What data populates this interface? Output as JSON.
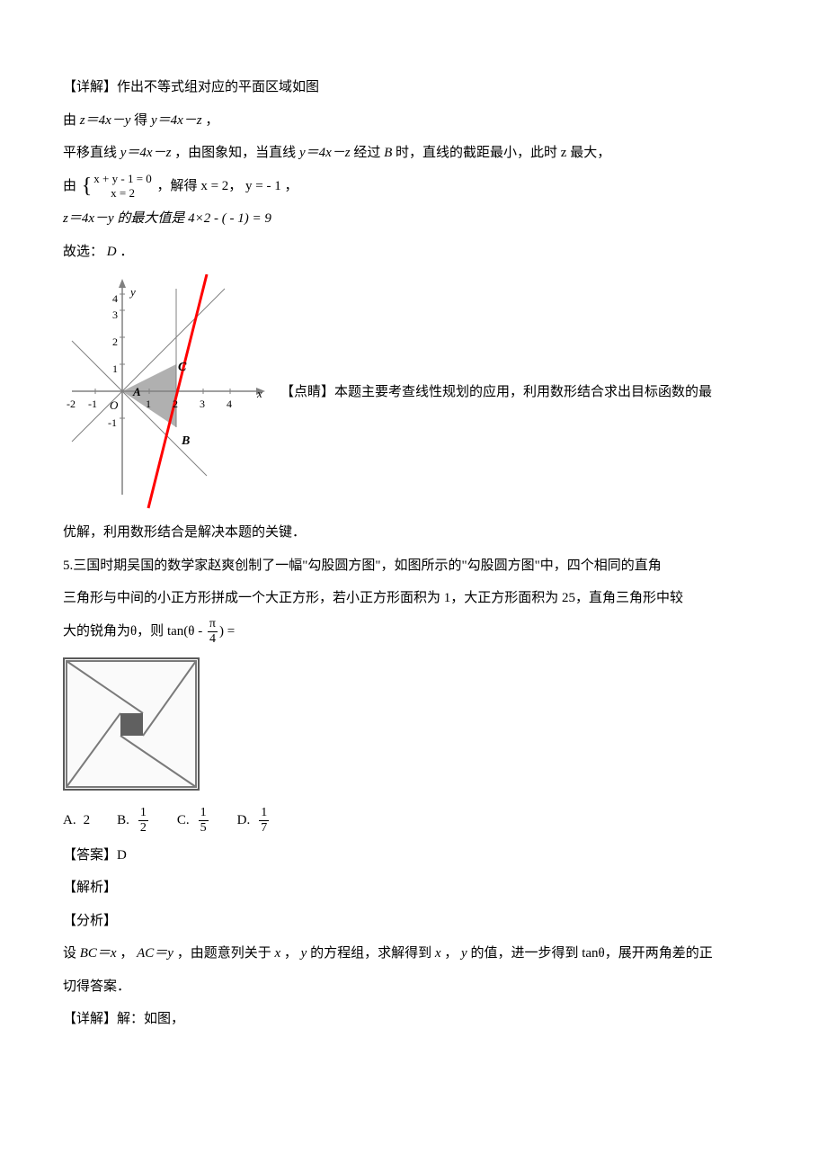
{
  "p1": "【详解】作出不等式组对应的平面区域如图",
  "p2_pre": "由 ",
  "p2_mid": " 得 ",
  "p2_end": "，",
  "eq_z": "z＝4x－y",
  "eq_y": "y＝4x－z",
  "p3_pre": "平移直线 ",
  "p3_mid": "，由图象知，当直线 ",
  "p3_post": " 经过 ",
  "p3_B": "B",
  "p3_end": " 时，直线的截距最小，此时 z 最大，",
  "p4_pre": "由",
  "brace_top": "x + y - 1 = 0",
  "brace_bot": "x = 2",
  "p4_mid": "，解得 ",
  "p4_sol": "x = 2， y = - 1",
  "p4_end": "，",
  "p5": "z＝4x－y 的最大值是 4×2 - ( - 1) = 9",
  "p6_pre": "故选：",
  "p6_ans": "D",
  "p6_end": "．",
  "graph": {
    "tick_4": "4",
    "tick_3": "3",
    "tick_2": "2",
    "tick_1": "1",
    "tick_n1": "-1",
    "tick_n2": "-2",
    "axis_x": "x",
    "axis_y": "y",
    "label_A": "A",
    "label_B": "B",
    "label_C": "C",
    "label_O": "O"
  },
  "hint_side": "【点睛】本题主要考查线性规划的应用，利用数形结合求出目标函数的最",
  "p_after": "优解，利用数形结合是解决本题的关键．",
  "q5a": "5.三国时期吴国的数学家赵爽创制了一幅\"勾股圆方图\"，如图所示的\"勾股圆方图\"中，四个相同的直角",
  "q5b": "三角形与中间的小正方形拼成一个大正方形，若小正方形面积为 1，大正方形面积为 25，直角三角形中较",
  "q5c_pre": "大的锐角为θ，则",
  "tan_expr_pre": "tan(θ - ",
  "tan_expr_post": ") =",
  "pi": "π",
  "four": "4",
  "opts": {
    "A_label": "A.",
    "A_val": "2",
    "B_label": "B.",
    "B_num": "1",
    "B_den": "2",
    "C_label": "C.",
    "C_num": "1",
    "C_den": "5",
    "D_label": "D.",
    "D_num": "1",
    "D_den": "7"
  },
  "ans_label": "【答案】D",
  "parse_label": "【解析】",
  "analysis_label": "【分析】",
  "analysis_text_pre": "设 ",
  "bc": "BC＝x",
  "analysis_text_mid1": "，",
  "ac": "AC＝y",
  "analysis_text_mid2": "，由题意列关于 ",
  "xy1": "x",
  "analysis_text_mid3": "，",
  "xy2": "y",
  "analysis_text_mid4": " 的方程组，求解得到 ",
  "analysis_text_mid5": " 的值，进一步得到 tanθ，展开两角差的正",
  "analysis_line2": "切得答案．",
  "detail_label": "【详解】解：如图，"
}
